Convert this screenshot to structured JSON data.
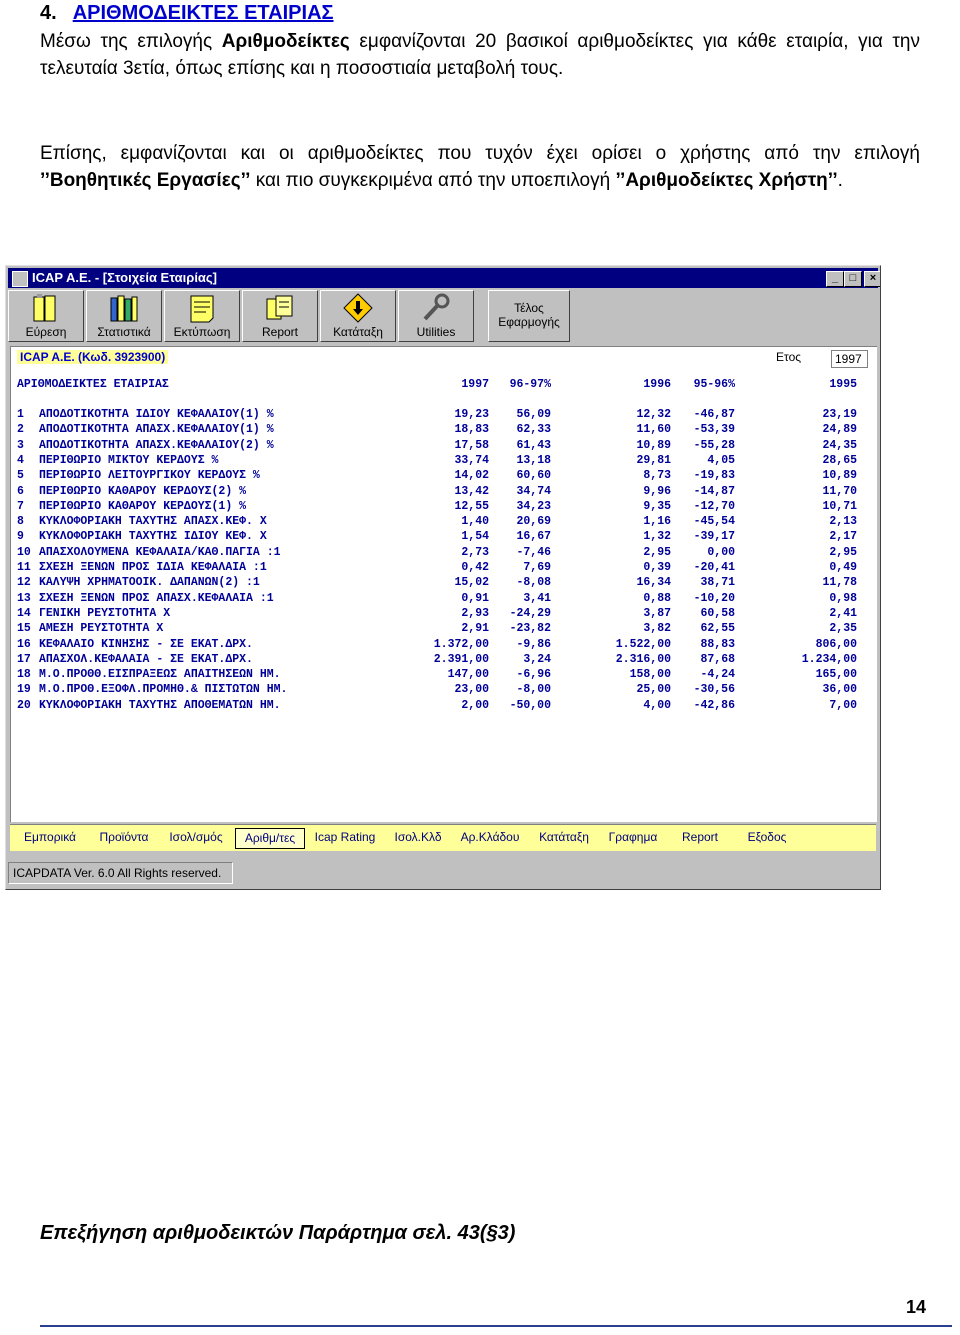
{
  "heading": {
    "number": "4.",
    "title": "ΑΡΙΘΜΟΔΕΙΚΤΕΣ ΕΤΑΙΡΙΑΣ"
  },
  "para1": {
    "a": "Μέσω της επιλογής ",
    "b": "Αριθμοδείκτες",
    "c": " εμφανίζονται 20 βασικοί αριθμοδείκτες για κάθε εταιρία, για την τελευταία 3ετία, όπως επίσης και η ποσοστιαία μεταβολή τους."
  },
  "para2": {
    "a": "Επίσης, εμφανίζονται και οι αριθμοδείκτες που τυχόν έχει ορίσει ο χρήστης από την επιλογή ",
    "b": "’’Βοηθητικές Εργασίες’’",
    "c": " και πιο συγκεκριμένα από την υποεπιλογή ",
    "d": "’’Αριθμοδείκτες Χρήστη’’",
    "e": "."
  },
  "window": {
    "title": "ICAP A.E. - [Στοιχεία Εταιρίας]",
    "toolbar": [
      "Εύρεση",
      "Στατιστικά",
      "Εκτύπωση",
      "Report",
      "Κατάταξη",
      "Utilities"
    ],
    "toolbar_end": {
      "line1": "Τέλος",
      "line2": "Εφαρμογής"
    },
    "company": "ICAP A.E. (Κωδ. 3923900)",
    "year_label": "Ετος",
    "year_value": "1997",
    "table_title": "ΑΡΙΘΜΟΔΕΙΚΤΕΣ ΕΤΑΙΡΙΑΣ",
    "columns": [
      "1997",
      "96-97%",
      "1996",
      "95-96%",
      "1995"
    ],
    "rows": [
      {
        "n": "1",
        "name": "ΑΠΟΔΟΤΙΚΟΤΗΤΑ ΙΔΙΟΥ ΚΕΦΑΛΑΙΟΥ(1) %",
        "v": [
          "19,23",
          "56,09",
          "12,32",
          "-46,87",
          "23,19"
        ]
      },
      {
        "n": "2",
        "name": "ΑΠΟΔΟΤΙΚΟΤΗΤΑ ΑΠΑΣΧ.ΚΕΦΑΛΑΙΟΥ(1) %",
        "v": [
          "18,83",
          "62,33",
          "11,60",
          "-53,39",
          "24,89"
        ]
      },
      {
        "n": "3",
        "name": "ΑΠΟΔΟΤΙΚΟΤΗΤΑ ΑΠΑΣΧ.ΚΕΦΑΛΑΙΟΥ(2) %",
        "v": [
          "17,58",
          "61,43",
          "10,89",
          "-55,28",
          "24,35"
        ]
      },
      {
        "n": "4",
        "name": "ΠΕΡΙΘΩΡΙΟ ΜΙΚΤΟΥ ΚΕΡΔΟΥΣ %",
        "v": [
          "33,74",
          "13,18",
          "29,81",
          "4,05",
          "28,65"
        ]
      },
      {
        "n": "5",
        "name": "ΠΕΡΙΘΩΡΙΟ ΛΕΙΤΟΥΡΓΙΚΟΥ ΚΕΡΔΟΥΣ %",
        "v": [
          "14,02",
          "60,60",
          "8,73",
          "-19,83",
          "10,89"
        ]
      },
      {
        "n": "6",
        "name": "ΠΕΡΙΘΩΡΙΟ ΚΑΘΑΡΟΥ ΚΕΡΔΟΥΣ(2) %",
        "v": [
          "13,42",
          "34,74",
          "9,96",
          "-14,87",
          "11,70"
        ]
      },
      {
        "n": "7",
        "name": "ΠΕΡΙΘΩΡΙΟ ΚΑΘΑΡΟΥ ΚΕΡΔΟΥΣ(1) %",
        "v": [
          "12,55",
          "34,23",
          "9,35",
          "-12,70",
          "10,71"
        ]
      },
      {
        "n": "8",
        "name": "ΚΥΚΛΟΦΟΡΙΑΚΗ ΤΑΧΥΤΗΣ ΑΠΑΣΧ.ΚΕΦ. Χ",
        "v": [
          "1,40",
          "20,69",
          "1,16",
          "-45,54",
          "2,13"
        ]
      },
      {
        "n": "9",
        "name": "ΚΥΚΛΟΦΟΡΙΑΚΗ ΤΑΧΥΤΗΣ ΙΔΙΟΥ ΚΕΦ. Χ",
        "v": [
          "1,54",
          "16,67",
          "1,32",
          "-39,17",
          "2,17"
        ]
      },
      {
        "n": "10",
        "name": "ΑΠΑΣΧΟΛΟΥΜΕΝΑ ΚΕΦΑΛΑΙΑ/ΚΑΘ.ΠΑΓΙΑ :1",
        "v": [
          "2,73",
          "-7,46",
          "2,95",
          "0,00",
          "2,95"
        ]
      },
      {
        "n": "11",
        "name": "ΣΧΕΣΗ ΞΕΝΩΝ ΠΡΟΣ ΙΔΙΑ ΚΕΦΑΛΑΙΑ :1",
        "v": [
          "0,42",
          "7,69",
          "0,39",
          "-20,41",
          "0,49"
        ]
      },
      {
        "n": "12",
        "name": "ΚΑΛΥΨΗ ΧΡΗΜΑΤΟΟΙΚ. ΔΑΠΑΝΩΝ(2) :1",
        "v": [
          "15,02",
          "-8,08",
          "16,34",
          "38,71",
          "11,78"
        ]
      },
      {
        "n": "13",
        "name": "ΣΧΕΣΗ ΞΕΝΩΝ ΠΡΟΣ ΑΠΑΣΧ.ΚΕΦΑΛΑΙΑ :1",
        "v": [
          "0,91",
          "3,41",
          "0,88",
          "-10,20",
          "0,98"
        ]
      },
      {
        "n": "14",
        "name": "ΓΕΝΙΚΗ ΡΕΥΣΤΟΤΗΤΑ Χ",
        "v": [
          "2,93",
          "-24,29",
          "3,87",
          "60,58",
          "2,41"
        ]
      },
      {
        "n": "15",
        "name": "ΑΜΕΣΗ ΡΕΥΣΤΟΤΗΤΑ Χ",
        "v": [
          "2,91",
          "-23,82",
          "3,82",
          "62,55",
          "2,35"
        ]
      },
      {
        "n": "16",
        "name": "ΚΕΦΑΛΑΙΟ ΚΙΝΗΣΗΣ - ΣΕ ΕΚΑΤ.ΔΡΧ.",
        "v": [
          "1.372,00",
          "-9,86",
          "1.522,00",
          "88,83",
          "806,00"
        ]
      },
      {
        "n": "17",
        "name": "ΑΠΑΣΧΟΛ.ΚΕΦΑΛΑΙΑ - ΣΕ ΕΚΑΤ.ΔΡΧ.",
        "v": [
          "2.391,00",
          "3,24",
          "2.316,00",
          "87,68",
          "1.234,00"
        ]
      },
      {
        "n": "18",
        "name": "Μ.Ο.ΠΡΟΘΘ.ΕΙΣΠΡΑΞΕΩΣ ΑΠΑΙΤΗΣΕΩΝ ΗΜ.",
        "v": [
          "147,00",
          "-6,96",
          "158,00",
          "-4,24",
          "165,00"
        ]
      },
      {
        "n": "19",
        "name": "Μ.Ο.ΠΡΟΘ.ΕΞΟΦΛ.ΠΡΟΜΗΘ.& ΠΙΣΤΩΤΩΝ ΗΜ.",
        "v": [
          "23,00",
          "-8,00",
          "25,00",
          "-30,56",
          "36,00"
        ]
      },
      {
        "n": "20",
        "name": "ΚΥΚΛΟΦΟΡΙΑΚΗ ΤΑΧΥΤΗΣ ΑΠΟΘΕΜΑΤΩΝ ΗΜ.",
        "v": [
          "2,00",
          "-50,00",
          "4,00",
          "-42,86",
          "7,00"
        ]
      }
    ],
    "tabs": [
      "Εμπορικά",
      "Προϊόντα",
      "Ισολ/σμός",
      "Αριθμ/τες",
      "Icap Rating",
      "Ισολ.Κλδ",
      "Αρ.Κλάδου",
      "Κατάταξη",
      "Γραφημα",
      "Report",
      "Εξοδος"
    ],
    "active_tab": "Αριθμ/τες",
    "status": "ICAPDATA Ver. 6.0 All Rights reserved."
  },
  "footnote": "Επεξήγηση αριθμοδεικτών Παράρτημα σελ. 43(§3)",
  "page_number": "14",
  "colors": {
    "title_bar": "#000080",
    "table_text": "#000099",
    "tab_bar": "#ffff99",
    "heading_text": "#0000cc",
    "footer_rule": "#2a3f8f"
  }
}
